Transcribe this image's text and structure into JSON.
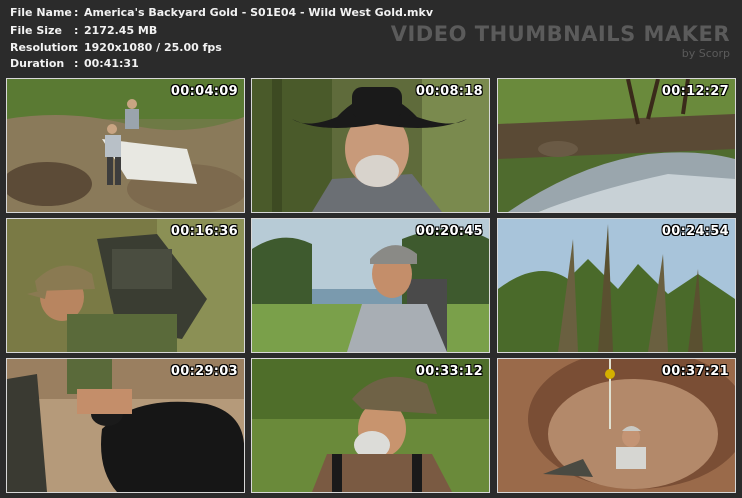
{
  "info": {
    "file_name_label": "File Name",
    "file_name": "America's Backyard Gold - S01E04 - Wild West Gold.mkv",
    "file_size_label": "File Size",
    "file_size": "2172.45 MB",
    "resolution_label": "Resolution",
    "resolution": "1920x1080 / 25.00 fps",
    "duration_label": "Duration",
    "duration": "00:41:31",
    "separator": ":"
  },
  "brand": {
    "title": "VIDEO THUMBNAILS MAKER",
    "subtitle": "by Scorp"
  },
  "thumbnails": [
    {
      "timestamp": "00:04:09",
      "scene": "two prospectors with tarp on rocky creek bank"
    },
    {
      "timestamp": "00:08:18",
      "scene": "bearded man in black cowboy hat"
    },
    {
      "timestamp": "00:12:27",
      "scene": "mountain stream through forest"
    },
    {
      "timestamp": "00:16:36",
      "scene": "man in cap carrying heavy backpack"
    },
    {
      "timestamp": "00:20:45",
      "scene": "man in baseball cap with backpack in meadow"
    },
    {
      "timestamp": "00:24:54",
      "scene": "tall weeds against blue sky"
    },
    {
      "timestamp": "00:29:03",
      "scene": "black dog and man kneeling on dirt"
    },
    {
      "timestamp": "00:33:12",
      "scene": "bearded man in camo hat looking up"
    },
    {
      "timestamp": "00:37:21",
      "scene": "man in hardhat in mine pit with rope"
    }
  ]
}
